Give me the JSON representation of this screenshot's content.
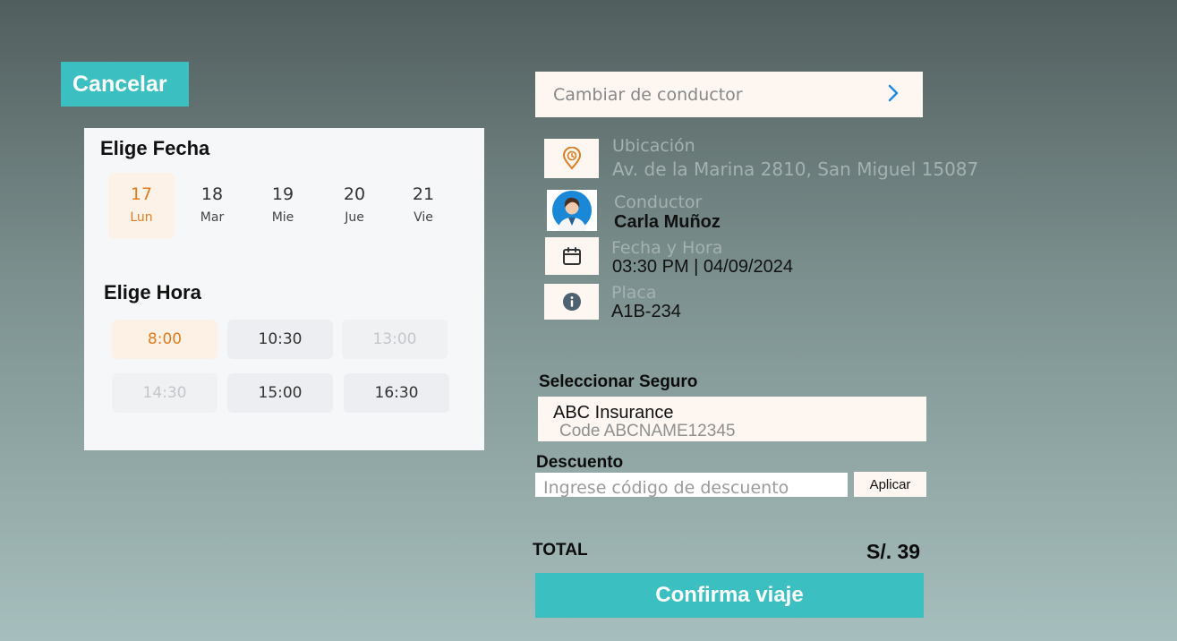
{
  "header": {
    "cancel_label": "Cancelar"
  },
  "schedule": {
    "date_title": "Elige Fecha",
    "days": [
      {
        "num": "17",
        "name": "Lun",
        "selected": true
      },
      {
        "num": "18",
        "name": "Mar"
      },
      {
        "num": "19",
        "name": "Mie"
      },
      {
        "num": "20",
        "name": "Jue"
      },
      {
        "num": "21",
        "name": "Vie"
      }
    ],
    "time_title": "Elige Hora",
    "times": [
      {
        "label": "8:00",
        "state": "selected"
      },
      {
        "label": "10:30",
        "state": "available"
      },
      {
        "label": "13:00",
        "state": "disabled"
      },
      {
        "label": "14:30",
        "state": "disabled"
      },
      {
        "label": "15:00",
        "state": "available"
      },
      {
        "label": "16:30",
        "state": "available"
      }
    ]
  },
  "trip": {
    "change_driver_label": "Cambiar de conductor",
    "location_label": "Ubicación",
    "location_value": "Av. de la Marina 2810, San Miguel 15087",
    "driver_label": "Conductor",
    "driver_value": "Carla Muñoz",
    "datetime_label": "Fecha y Hora",
    "datetime_value": "03:30 PM | 04/09/2024",
    "plate_label": "Placa",
    "plate_value": "A1B-234"
  },
  "insurance": {
    "title": "Seleccionar Seguro",
    "name": "ABC Insurance",
    "code": "Code ABCNAME12345"
  },
  "discount": {
    "title": "Descuento",
    "placeholder": "Ingrese código de descuento",
    "apply_label": "Aplicar"
  },
  "total": {
    "label": "TOTAL",
    "value": "S/. 39"
  },
  "confirm_label": "Confirma viaje",
  "colors": {
    "accent": "#3bbfc1",
    "orange": "#e07d22",
    "cream": "#fdf6f1"
  }
}
